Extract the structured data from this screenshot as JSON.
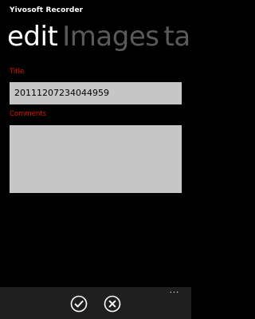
{
  "app": {
    "title": "Yivosoft Recorder"
  },
  "pivot": {
    "items": [
      {
        "label": "edit"
      },
      {
        "label": "Images"
      },
      {
        "label": "tasks"
      }
    ]
  },
  "form": {
    "title_label": "Title",
    "title_value": "20111207234044959",
    "comments_label": "Comments",
    "comments_value": ""
  },
  "appbar": {
    "ellipsis": "...",
    "buttons": [
      {
        "icon": "check-icon"
      },
      {
        "icon": "close-icon"
      }
    ]
  },
  "colors": {
    "accent": "#e51400",
    "background": "#000000",
    "textbox": "#c6c6c6",
    "pivot_inactive": "#5a5a5a",
    "appbar": "#1f1f1f"
  }
}
